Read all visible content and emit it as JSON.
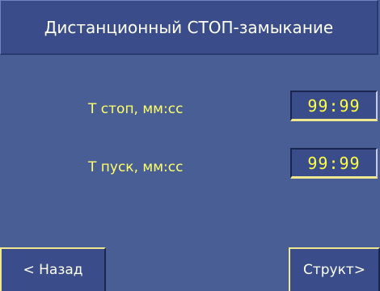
{
  "header": {
    "title": "Дистанционный СТОП-замыкание"
  },
  "rows": [
    {
      "label": "Т стоп, мм:сс",
      "value": "99:99"
    },
    {
      "label": "Т пуск, мм:сс",
      "value": "99:99"
    }
  ],
  "nav": {
    "back_label": "< Назад",
    "struct_label": "Структ>"
  },
  "colors": {
    "background": "#4a5e96",
    "panel": "#3a4d8a",
    "label_text": "#ffff66",
    "value_text": "#ffff44",
    "title_text": "#fffff0"
  }
}
